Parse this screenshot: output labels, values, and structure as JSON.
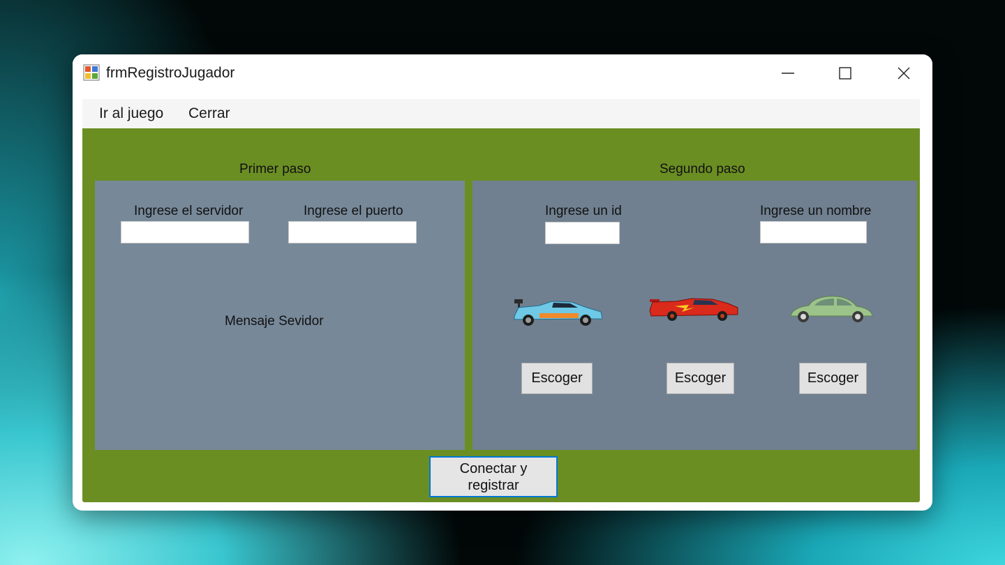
{
  "window": {
    "title": "frmRegistroJugador",
    "controls": {
      "minimize": "—",
      "maximize": "☐",
      "close": "✕"
    }
  },
  "menu": {
    "items": [
      "Ir al juego",
      "Cerrar"
    ]
  },
  "colors": {
    "form_background": "#6b8e23",
    "panel_background": "#778899",
    "panel2_background": "#708090"
  },
  "step1": {
    "title": "Primer paso",
    "server_label": "Ingrese el servidor",
    "server_value": "",
    "port_label": "Ingrese el puerto",
    "port_value": "",
    "message": "Mensaje Sevidor"
  },
  "step2": {
    "title": "Segundo paso",
    "id_label": "Ingrese un id",
    "id_value": "",
    "name_label": "Ingrese un nombre",
    "name_value": "",
    "cars": [
      {
        "icon": "blue-race-car-icon",
        "button": "Escoger"
      },
      {
        "icon": "red-race-car-icon",
        "button": "Escoger"
      },
      {
        "icon": "green-beetle-car-icon",
        "button": "Escoger"
      }
    ]
  },
  "connect_button": {
    "line1": "Conectar y",
    "line2": "registrar"
  }
}
